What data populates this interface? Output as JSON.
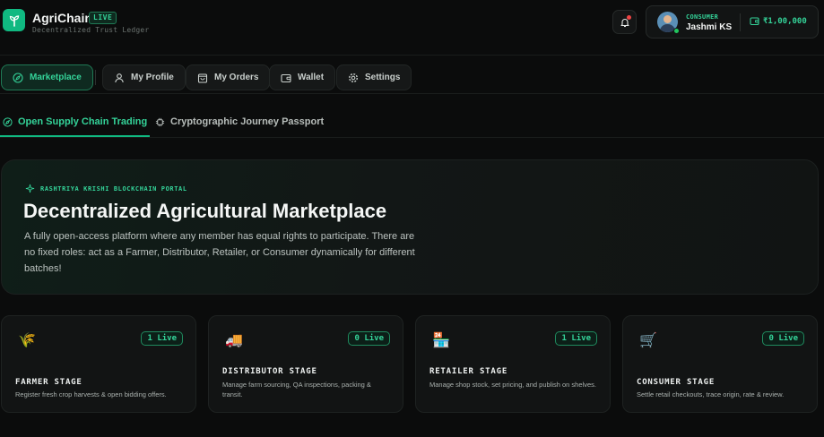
{
  "header": {
    "brand": "AgriChain",
    "live_badge": "LIVE",
    "tagline": "Decentralized Trust Ledger",
    "user": {
      "role": "CONSUMER",
      "name": "Jashmi KS",
      "balance": "₹1,00,000"
    }
  },
  "nav": {
    "items": [
      {
        "label": "Marketplace",
        "icon": "compass-icon",
        "active": true
      },
      {
        "label": "My Profile",
        "icon": "user-icon"
      },
      {
        "label": "My Orders",
        "icon": "bag-icon"
      },
      {
        "label": "Wallet",
        "icon": "wallet-icon"
      },
      {
        "label": "Settings",
        "icon": "gear-icon"
      }
    ]
  },
  "subtabs": [
    {
      "label": "Open Supply Chain Trading",
      "icon": "compass-icon",
      "active": true
    },
    {
      "label": "Cryptographic Journey Passport",
      "icon": "chip-icon"
    }
  ],
  "hero": {
    "kicker": "RASHTRIYA KRISHI BLOCKCHAIN PORTAL",
    "title": "Decentralized Agricultural Marketplace",
    "description": "A fully open-access platform where any member has equal rights to participate. There are no fixed roles: act as a Farmer, Distributor, Retailer, or Consumer dynamically for different batches!"
  },
  "stages": [
    {
      "icon": "🌾",
      "icon_name": "wheat-icon",
      "badge": "1 Live",
      "title": "FARMER STAGE",
      "description": "Register fresh crop harvests & open bidding offers."
    },
    {
      "icon": "🚚",
      "icon_name": "truck-icon",
      "badge": "0 Live",
      "title": "DISTRIBUTOR STAGE",
      "description": "Manage farm sourcing, QA inspections, packing & transit."
    },
    {
      "icon": "🏪",
      "icon_name": "store-icon",
      "badge": "1 Live",
      "title": "RETAILER STAGE",
      "description": "Manage shop stock, set pricing, and publish on shelves."
    },
    {
      "icon": "🛒",
      "icon_name": "cart-icon",
      "badge": "0 Live",
      "title": "CONSUMER STAGE",
      "description": "Settle retail checkouts, trace origin, rate & review."
    }
  ],
  "colors": {
    "accent": "#10b981",
    "accent_text": "#34d399",
    "background": "#0b0c0c",
    "notification": "#ef4444"
  }
}
